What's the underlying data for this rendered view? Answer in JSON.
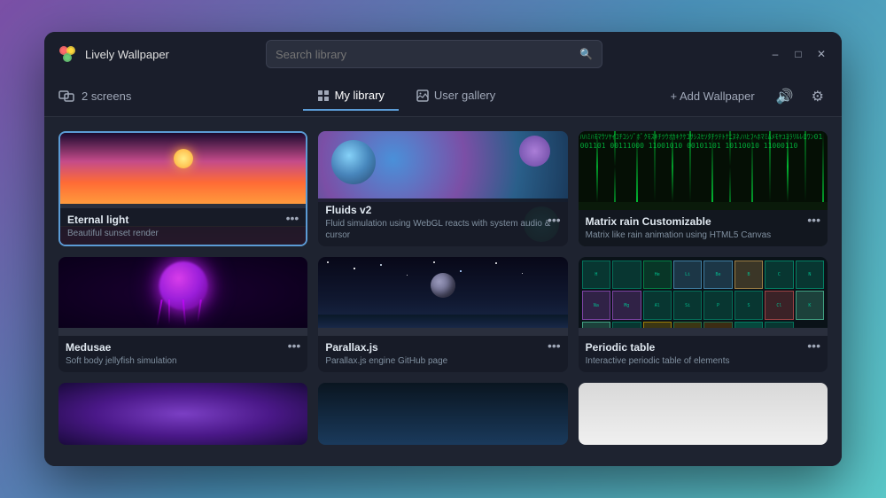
{
  "app": {
    "title": "Lively Wallpaper"
  },
  "titlebar": {
    "search_placeholder": "Search library",
    "minimize_label": "–",
    "maximize_label": "□",
    "close_label": "✕"
  },
  "navbar": {
    "screens_label": "2 screens",
    "tabs": [
      {
        "id": "my-library",
        "label": "My library",
        "active": true
      },
      {
        "id": "user-gallery",
        "label": "User gallery",
        "active": false
      }
    ],
    "add_wallpaper_label": "+ Add Wallpaper",
    "volume_icon": "volume",
    "settings_icon": "settings"
  },
  "wallpapers": [
    {
      "id": "eternal-light",
      "title": "Eternal light",
      "description": "Beautiful sunset render",
      "selected": true,
      "bg_type": "sunset"
    },
    {
      "id": "fluids-v2",
      "title": "Fluids v2",
      "description": "Fluid simulation using WebGL reacts with system audio & cursor",
      "selected": false,
      "bg_type": "fluids"
    },
    {
      "id": "matrix-rain",
      "title": "Matrix rain Customizable",
      "description": "Matrix like rain animation using HTML5 Canvas",
      "selected": false,
      "bg_type": "matrix"
    },
    {
      "id": "medusae",
      "title": "Medusae",
      "description": "Soft body jellyfish simulation",
      "selected": false,
      "bg_type": "jellyfish"
    },
    {
      "id": "parallax-js",
      "title": "Parallax.js",
      "description": "Parallax.js engine GitHub page",
      "selected": false,
      "bg_type": "parallax"
    },
    {
      "id": "periodic-table",
      "title": "Periodic table",
      "description": "Interactive periodic table of elements",
      "selected": false,
      "bg_type": "periodic"
    },
    {
      "id": "row3-1",
      "title": "",
      "description": "",
      "selected": false,
      "bg_type": "purple-abstract"
    },
    {
      "id": "row3-2",
      "title": "",
      "description": "",
      "selected": false,
      "bg_type": "dark-scene"
    },
    {
      "id": "row3-3",
      "title": "",
      "description": "",
      "selected": false,
      "bg_type": "light"
    }
  ],
  "matrix_chars": "ﾊﾊﾐﾊﾓﾏｳｿﾔｲｺﾁｺｼｿﾞﾎﾞｸﾓｽｷﾁﾂｳｵｶｷｸｹｺｻｼｽｾｿﾀﾁﾂﾃﾄﾅﾆﾇﾈﾉﾊﾋﾌﾍﾎﾏﾐﾑﾒﾓﾔﾕﾖﾗﾘﾙﾚﾛﾜﾝ01001101 00111000 11001010 00101101 10110010 11000110"
}
